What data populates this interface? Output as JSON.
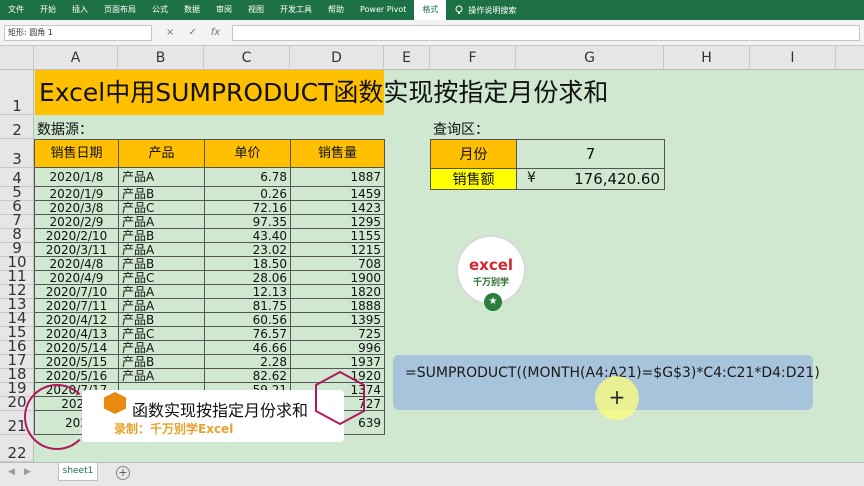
{
  "ribbon": {
    "tabs": [
      "文件",
      "开始",
      "插入",
      "页面布局",
      "公式",
      "数据",
      "审阅",
      "视图",
      "开发工具",
      "帮助",
      "Power Pivot",
      "格式"
    ],
    "active_tab": "格式",
    "search_label": "操作说明搜索"
  },
  "formula_bar": {
    "name_box": "矩形: 圆角 1",
    "cancel": "×",
    "enter": "✓",
    "fx": "fx"
  },
  "columns": [
    "A",
    "B",
    "C",
    "D",
    "E",
    "F",
    "G",
    "H",
    "I"
  ],
  "rows": [
    "1",
    "2",
    "3",
    "4",
    "5",
    "6",
    "7",
    "8",
    "9",
    "10",
    "11",
    "12",
    "13",
    "14",
    "15",
    "16",
    "17",
    "18",
    "19",
    "20",
    "21",
    "22"
  ],
  "sheet": {
    "title": "Excel中用SUMPRODUCT函数实现按指定月份求和",
    "source_label": "数据源：",
    "query_label": "查询区：",
    "headers": [
      "销售日期",
      "产品",
      "单价",
      "销售量"
    ],
    "data": [
      [
        "2020/1/8",
        "产品A",
        "6.78",
        "1887"
      ],
      [
        "2020/1/9",
        "产品B",
        "0.26",
        "1459"
      ],
      [
        "2020/3/8",
        "产品C",
        "72.16",
        "1423"
      ],
      [
        "2020/2/9",
        "产品A",
        "97.35",
        "1295"
      ],
      [
        "2020/2/10",
        "产品B",
        "43.40",
        "1155"
      ],
      [
        "2020/3/11",
        "产品A",
        "23.02",
        "1215"
      ],
      [
        "2020/4/8",
        "产品B",
        "18.50",
        "708"
      ],
      [
        "2020/4/9",
        "产品C",
        "28.06",
        "1900"
      ],
      [
        "2020/7/10",
        "产品A",
        "12.13",
        "1820"
      ],
      [
        "2020/7/11",
        "产品A",
        "81.75",
        "1888"
      ],
      [
        "2020/4/12",
        "产品B",
        "60.56",
        "1395"
      ],
      [
        "2020/4/13",
        "产品C",
        "76.57",
        "725"
      ],
      [
        "2020/5/14",
        "产品A",
        "46.66",
        "996"
      ],
      [
        "2020/5/15",
        "产品B",
        "2.28",
        "1937"
      ],
      [
        "2020/5/16",
        "产品A",
        "82.62",
        "1920"
      ],
      [
        "2020/7/17",
        "",
        "59.21",
        "1374"
      ],
      [
        "2020",
        "",
        "",
        "727"
      ],
      [
        "202",
        "",
        "",
        "639"
      ]
    ],
    "query": {
      "month_label": "月份",
      "month_value": "7",
      "sales_label": "销售额",
      "currency": "¥",
      "sales_value": "176,420.60"
    }
  },
  "logo": {
    "line1": "excel",
    "line2": "千万别学",
    "star": "★"
  },
  "formula_box": {
    "text": "=SUMPRODUCT((MONTH(A4:A21)=$G$3)*C4:C21*D4:D21)"
  },
  "cursor_symbol": "+",
  "banner": {
    "title": "函数实现按指定月份求和",
    "subtitle": "录制：千万别学Excel"
  },
  "sheet_tab": {
    "name": "sheet1",
    "add": "+"
  },
  "colors": {
    "ribbon": "#1e7145",
    "header_fill": "#fec000",
    "sales_fill": "#ffff00",
    "grid_bg": "#cfe8cf",
    "formula_box": "#a8c4dc"
  }
}
